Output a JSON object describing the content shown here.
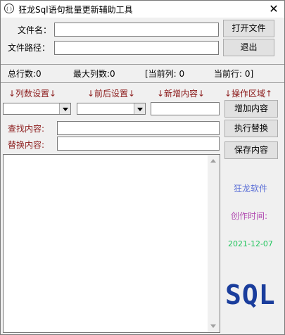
{
  "window": {
    "title": "狂龙Sql语句批量更新辅助工具",
    "icon_text": "( )",
    "close_glyph": "✕"
  },
  "file": {
    "name_label": "文件名：",
    "path_label": "文件路径：",
    "name_value": "",
    "path_value": "",
    "open_button": "打开文件",
    "exit_button": "退出"
  },
  "stats": {
    "total_rows": "总行数:0",
    "max_cols": "最大列数:0",
    "current_col": "[当前列: 0",
    "current_row": "当前行: 0]"
  },
  "sections": {
    "col_setting": "↓列数设置↓",
    "prefix_setting": "↓前后设置↓",
    "new_content": "↓新增内容↓",
    "operation_area": "↓操作区域↑"
  },
  "controls": {
    "col_select_value": "",
    "prefix_select_value": "",
    "new_content_value": "",
    "add_button": "增加内容",
    "find_label": "查找内容:",
    "find_value": "",
    "execute_button": "执行替换",
    "replace_label": "替换内容:",
    "replace_value": "",
    "save_button": "保存内容"
  },
  "side": {
    "brand": "狂龙软件",
    "created_label": "创作时间:",
    "date": "2021-12-07",
    "logo": "SQL"
  },
  "colors": {
    "label_red": "#8b1a1a",
    "brand_blue": "#5b6fd6",
    "created_purple": "#b048b0",
    "date_green": "#22c55e",
    "logo_blue": "#1a3d9c"
  },
  "memo": {
    "content": ""
  }
}
